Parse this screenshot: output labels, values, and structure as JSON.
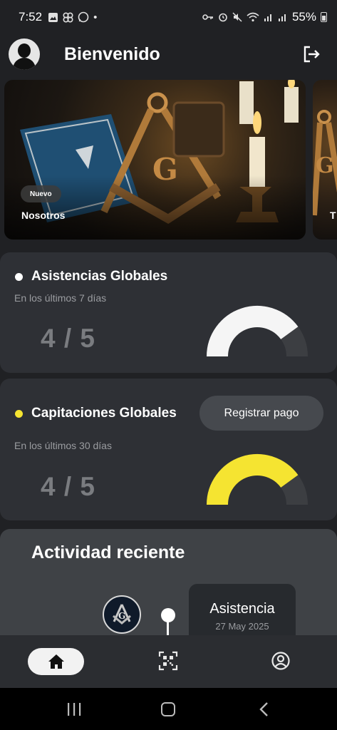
{
  "status_bar": {
    "time": "7:52",
    "dot": "•",
    "battery": "55%",
    "left_icons": [
      "image-icon",
      "pinwheel-icon",
      "whatsapp-icon"
    ],
    "right_icons": [
      "key-icon",
      "alarm-icon",
      "mute-icon",
      "wifi-icon",
      "signal-icon",
      "battery-icon"
    ]
  },
  "header": {
    "title": "Bienvenido",
    "logout_icon": "logout-icon"
  },
  "carousel": {
    "items": [
      {
        "badge": "Nuevo",
        "title": "Nosotros"
      },
      {
        "title": "T"
      }
    ]
  },
  "attendance": {
    "title": "Asistencias Globales",
    "subtitle": "En los últimos 7 días",
    "value": "4 / 5",
    "progress": 0.8,
    "dot_color": "#ffffff",
    "gauge_color": "#f5f5f5",
    "track_color": "#3c3e42"
  },
  "capitation": {
    "title": "Capitaciones Globales",
    "subtitle": "En los últimos 30 días",
    "value": "4 / 5",
    "progress": 0.8,
    "button_label": "Registrar pago",
    "dot_color": "#f5e431",
    "gauge_color": "#f5e431",
    "track_color": "#3c3e42"
  },
  "activity": {
    "title": "Actividad reciente",
    "items": [
      {
        "type": "Asistencia",
        "date": "27 May 2025"
      }
    ]
  },
  "bottom_nav": {
    "items": [
      "home-icon",
      "qr-code-icon",
      "profile-icon"
    ],
    "active": "home-icon"
  }
}
